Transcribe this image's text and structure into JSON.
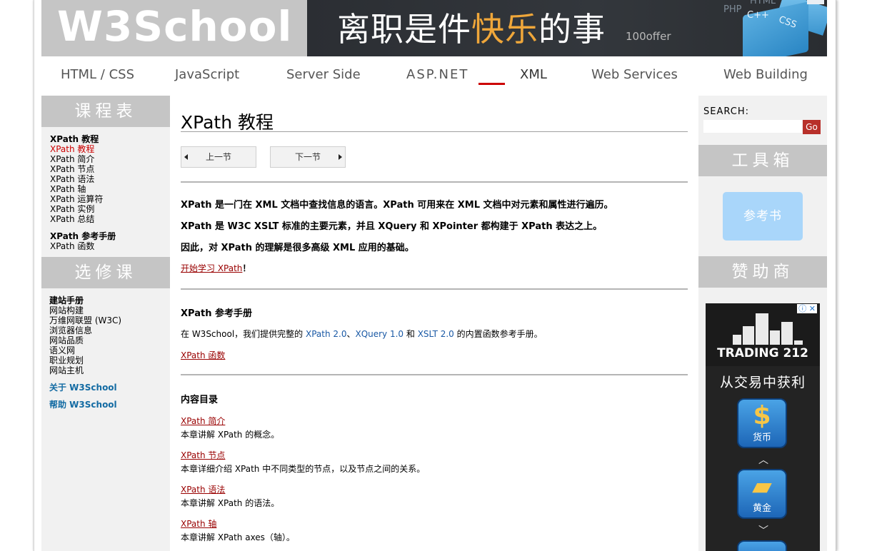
{
  "header": {
    "logo": "W3School",
    "banner": {
      "text_before": "离职是件",
      "text_highlight": "快乐",
      "text_after": "的事",
      "brand": "100offer",
      "tech_words": [
        "PHP",
        "HTML",
        "C++",
        "CSS"
      ]
    }
  },
  "nav": {
    "items": [
      {
        "label": "HTML / CSS"
      },
      {
        "label": "JavaScript"
      },
      {
        "label": "Server Side"
      },
      {
        "label": "ASP.NET"
      },
      {
        "label": "XML"
      },
      {
        "label": "Web Services"
      },
      {
        "label": "Web Building"
      }
    ],
    "active": "XML"
  },
  "left_sidebar": {
    "heading1": "课程表",
    "course": {
      "title": "XPath 教程",
      "items": [
        "XPath 教程",
        "XPath 简介",
        "XPath 节点",
        "XPath 语法",
        "XPath 轴",
        "XPath 运算符",
        "XPath 实例",
        "XPath 总结"
      ],
      "current": "XPath 教程",
      "ref_title": "XPath 参考手册",
      "ref_items": [
        "XPath 函数"
      ]
    },
    "heading2": "选修课",
    "elective": {
      "title": "建站手册",
      "items": [
        "网站构建",
        "万维网联盟 (W3C)",
        "浏览器信息",
        "网站品质",
        "语义网",
        "职业规划",
        "网站主机"
      ]
    },
    "about": "关于 W3School",
    "help": "帮助 W3School"
  },
  "main": {
    "title": "XPath 教程",
    "prev_label": "上一节",
    "next_label": "下一节",
    "intro": [
      "XPath 是一门在 XML 文档中查找信息的语言。XPath 可用来在 XML 文档中对元素和属性进行遍历。",
      "XPath 是 W3C XSLT 标准的主要元素，并且 XQuery 和 XPointer 都构建于 XPath 表达之上。",
      "因此，对 XPath 的理解是很多高级 XML 应用的基础。"
    ],
    "start_link": "开始学习 XPath",
    "start_suffix": "！",
    "ref_heading": "XPath 参考手册",
    "ref_text": {
      "p1": "在 W3School，我们提供完整的 ",
      "xpath": "XPath 2.0",
      "sep1": "、",
      "xquery": "XQuery 1.0",
      "and": " 和 ",
      "xslt": "XSLT 2.0",
      "p2": " 的内置函数参考手册。"
    },
    "ref_link": "XPath 函数",
    "toc_heading": "内容目录",
    "toc": [
      {
        "link": "XPath 简介",
        "desc": "本章讲解 XPath 的概念。"
      },
      {
        "link": "XPath 节点",
        "desc": "本章详细介绍 XPath 中不同类型的节点，以及节点之间的关系。"
      },
      {
        "link": "XPath 语法",
        "desc": "本章讲解 XPath 的语法。"
      },
      {
        "link": "XPath 轴",
        "desc": "本章讲解 XPath axes（轴）。"
      }
    ]
  },
  "right_sidebar": {
    "search_label": "SEARCH:",
    "search_value": "",
    "go_label": "Go",
    "toolbox_heading": "工具箱",
    "ref_book": "参考书",
    "sponsor_heading": "赞助商",
    "ad": {
      "brand": "TRADING 212",
      "headline": "从交易中获利",
      "icons": [
        {
          "symbol": "$",
          "caption": "货币"
        },
        {
          "symbol": "▰",
          "caption": "黄金"
        }
      ]
    }
  },
  "colors": {
    "header_gray": "#c5c5c5",
    "sidebar_bg": "#f1f1f1",
    "link_red": "#990000",
    "accent_red": "#cc0000",
    "go_button": "#b8302a",
    "ref_button": "#a9d6fa",
    "about_blue": "#136ba3"
  }
}
